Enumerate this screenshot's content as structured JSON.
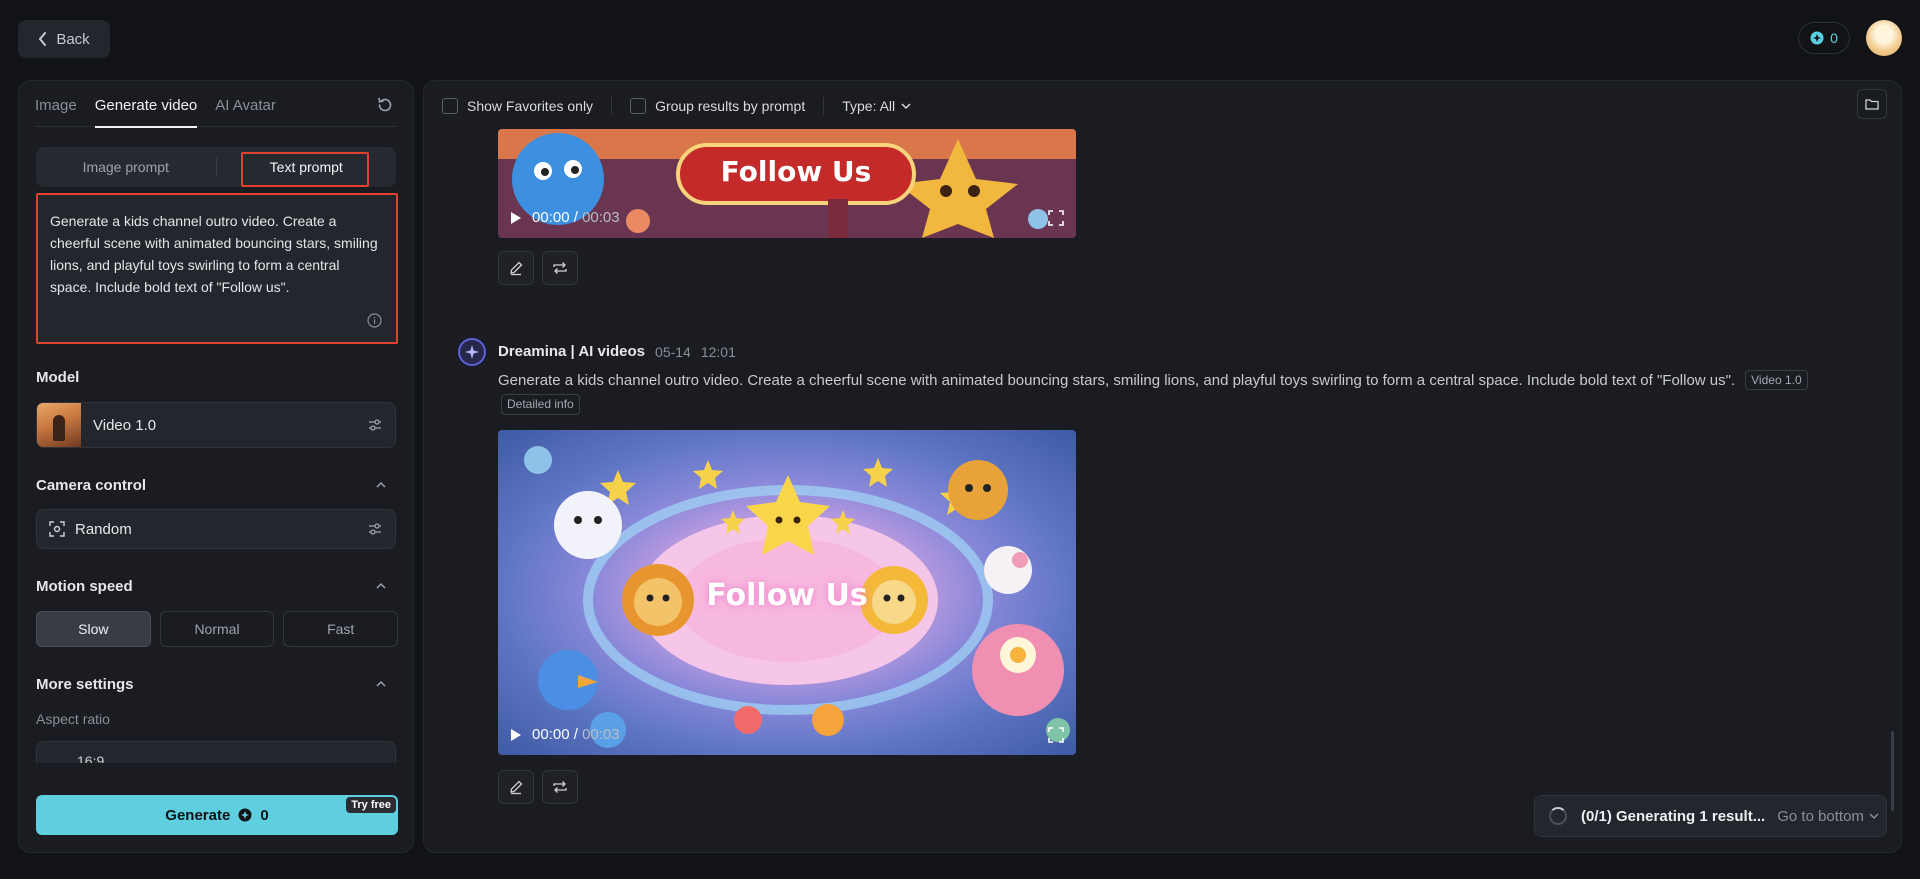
{
  "top": {
    "back_label": "Back",
    "credits": "0"
  },
  "sidebar": {
    "tabs": [
      {
        "label": "Image"
      },
      {
        "label": "Generate video"
      },
      {
        "label": "AI Avatar"
      }
    ],
    "prompt_modes": [
      {
        "label": "Image prompt"
      },
      {
        "label": "Text prompt"
      }
    ],
    "prompt_text": "Generate a kids channel outro video. Create a cheerful scene with animated bouncing stars, smiling lions, and playful toys swirling to form a central space. Include bold text of \"Follow us\".",
    "model_label": "Model",
    "model_name": "Video 1.0",
    "camera_label": "Camera control",
    "camera_value": "Random",
    "motion_label": "Motion speed",
    "speeds": [
      {
        "label": "Slow"
      },
      {
        "label": "Normal"
      },
      {
        "label": "Fast"
      }
    ],
    "more_label": "More settings",
    "aspect_label": "Aspect ratio",
    "aspect_value": "16:9",
    "generate_label": "Generate",
    "generate_cost": "0",
    "try_free": "Try free"
  },
  "main": {
    "filters": {
      "favorites": "Show Favorites only",
      "group": "Group results by prompt",
      "type": "Type: All"
    },
    "video1": {
      "time": "00:00",
      "duration": "00:03",
      "overlay_text": "Follow Us"
    },
    "message": {
      "author": "Dreamina | AI videos",
      "date": "05-14",
      "time": "12:01",
      "text": "Generate a kids channel outro video. Create a cheerful scene with animated bouncing stars, smiling lions, and playful toys swirling to form a central space. Include bold text of \"Follow us\".",
      "model_tag": "Video 1.0",
      "detail_label": "Detailed info"
    },
    "video2": {
      "time": "00:00",
      "duration": "00:03",
      "overlay_text": "Follow Us"
    },
    "status": {
      "generating": "(0/1) Generating 1 result...",
      "go_bottom": "Go to bottom"
    }
  },
  "colors": {
    "accent": "#5fcfdf",
    "highlight": "#e2412f",
    "background": "#111317"
  }
}
